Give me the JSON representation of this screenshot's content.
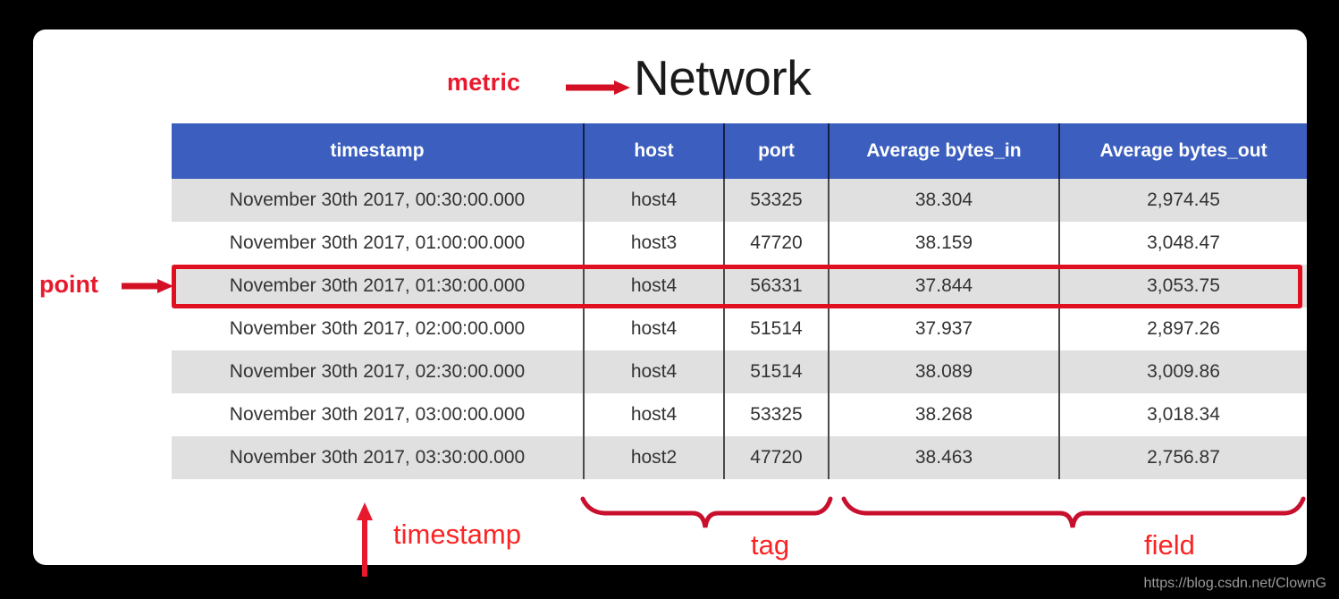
{
  "title": "Network",
  "annotations": {
    "metric": "metric",
    "point": "point",
    "timestamp": "timestamp",
    "tag": "tag",
    "field": "field"
  },
  "colors": {
    "header_blue": "#3c5fbf",
    "annotation_red": "#e8192c",
    "brace_red": "#c8102e",
    "row_stripe": "#e0e0e0",
    "card_background": "#ffffff",
    "page_background": "#000000"
  },
  "table": {
    "columns": [
      "timestamp",
      "host",
      "port",
      "Average bytes_in",
      "Average bytes_out"
    ],
    "rows": [
      [
        "November 30th 2017, 00:30:00.000",
        "host4",
        "53325",
        "38.304",
        "2,974.45"
      ],
      [
        "November 30th 2017, 01:00:00.000",
        "host3",
        "47720",
        "38.159",
        "3,048.47"
      ],
      [
        "November 30th 2017, 01:30:00.000",
        "host4",
        "56331",
        "37.844",
        "3,053.75"
      ],
      [
        "November 30th 2017, 02:00:00.000",
        "host4",
        "51514",
        "37.937",
        "2,897.26"
      ],
      [
        "November 30th 2017, 02:30:00.000",
        "host4",
        "51514",
        "38.089",
        "3,009.86"
      ],
      [
        "November 30th 2017, 03:00:00.000",
        "host4",
        "53325",
        "38.268",
        "3,018.34"
      ],
      [
        "November 30th 2017, 03:30:00.000",
        "host2",
        "47720",
        "38.463",
        "2,756.87"
      ]
    ],
    "highlighted_row_index": 2
  },
  "watermark": "https://blog.csdn.net/ClownG"
}
